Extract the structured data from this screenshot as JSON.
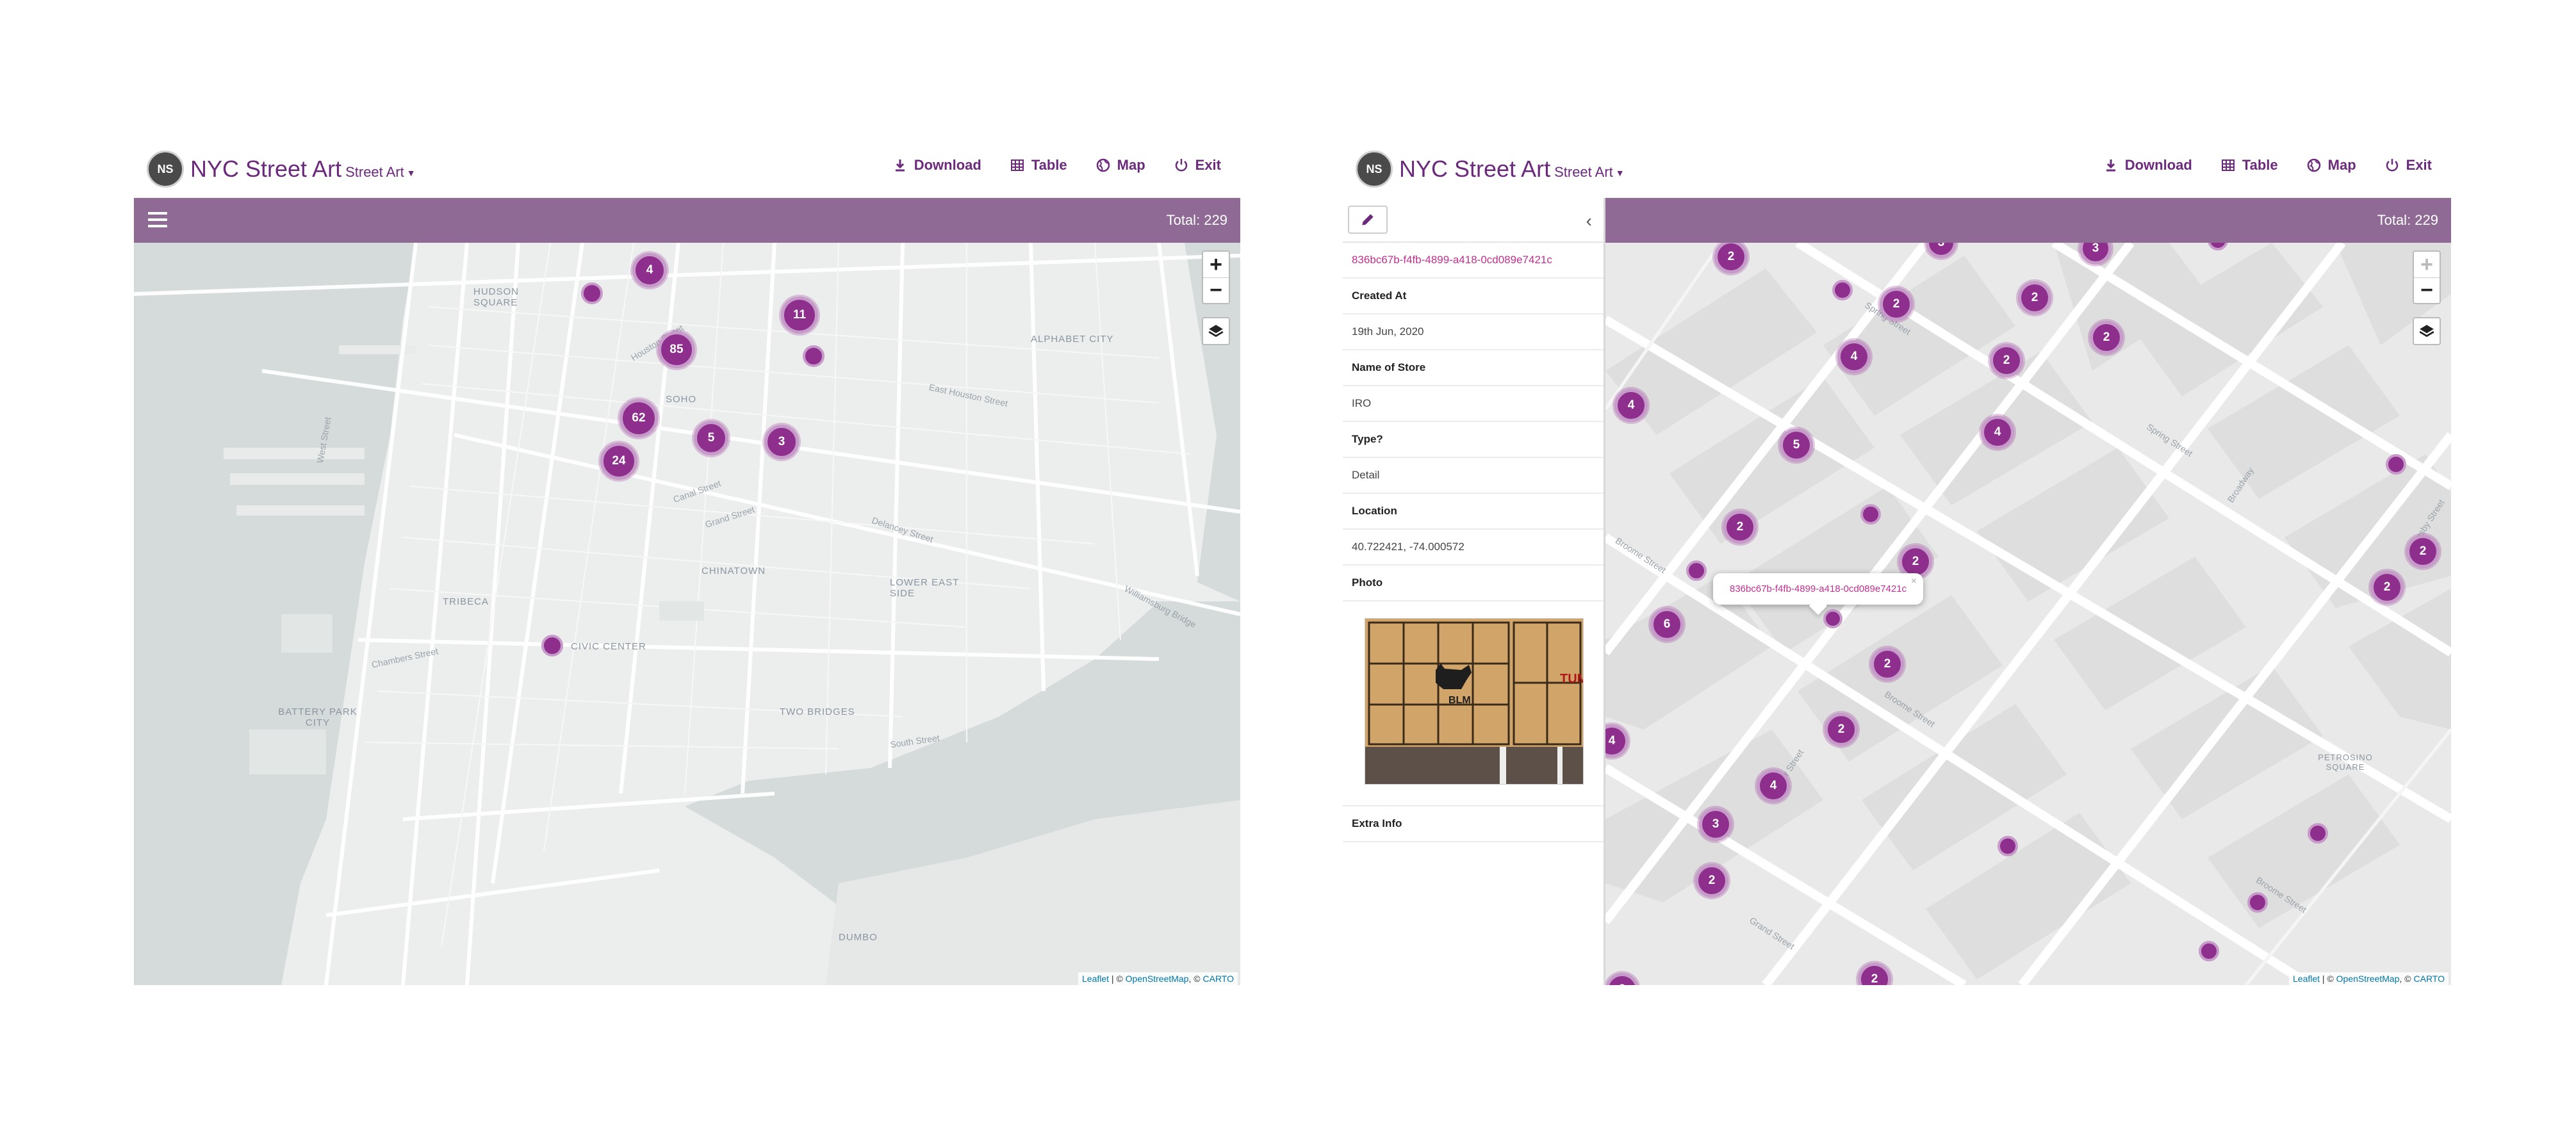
{
  "app": {
    "avatar_initials": "NS",
    "title": "NYC Street Art",
    "subtitle": "Street Art",
    "total_label": "Total: 229"
  },
  "actions": [
    {
      "label": "Download",
      "icon": "download-icon"
    },
    {
      "label": "Table",
      "icon": "table-icon"
    },
    {
      "label": "Map",
      "icon": "globe-icon"
    },
    {
      "label": "Exit",
      "icon": "power-icon"
    }
  ],
  "map_controls": {
    "zoom_in": "+",
    "zoom_out": "−"
  },
  "attribution": {
    "leaflet": "Leaflet",
    "sep1": " | © ",
    "osm": "OpenStreetMap",
    "sep2": ", © ",
    "carto": "CARTO"
  },
  "left_map": {
    "clusters": [
      "4",
      "11",
      "85",
      "62",
      "5",
      "3",
      "24"
    ],
    "neighborhoods": [
      "HUDSON SQUARE",
      "SOHO",
      "ALPHABET CITY",
      "TRIBECA",
      "CHINATOWN",
      "LOWER EAST SIDE",
      "CIVIC CENTER",
      "BATTERY PARK CITY",
      "TWO BRIDGES",
      "DUMBO"
    ],
    "streets": [
      "Houston Street",
      "East Houston Street",
      "Canal Street",
      "Delancey Street",
      "Chambers Street",
      "South Street",
      "Williamsburg Bridge",
      "Grand Street",
      "West Street"
    ]
  },
  "right_map": {
    "clusters": [
      "3",
      "2",
      "2",
      "2",
      "3",
      "2",
      "4",
      "2",
      "4",
      "4",
      "5",
      "2",
      "2",
      "6",
      "2",
      "2",
      "2",
      "2",
      "4",
      "4",
      "3",
      "2",
      "2",
      "2"
    ],
    "streets": [
      "Broome Street",
      "Spring Street",
      "Grand Street",
      "Broadway",
      "Crosby Street",
      "Mercer Street"
    ],
    "neighborhoods": [
      "PETROSINO SQUARE"
    ],
    "popup_id": "836bc67b-f4fb-4899-a418-0cd089e7421c"
  },
  "detail": {
    "id": "836bc67b-f4fb-4899-a418-0cd089e7421c",
    "fields": [
      {
        "label": "Created At",
        "value": "19th Jun, 2020"
      },
      {
        "label": "Name of Store",
        "value": "IRO"
      },
      {
        "label": "Type?",
        "value": "Detail"
      },
      {
        "label": "Location",
        "value": "40.722421, -74.000572"
      }
    ],
    "photo_label": "Photo",
    "photo_text": "BLM",
    "photo_side_text": "TUM",
    "extra_label": "Extra Info"
  },
  "colors": {
    "accent": "#6b2a7c",
    "toolbar": "#8e6a95",
    "cluster": "#8e2f8e",
    "link": "#c0308f"
  }
}
